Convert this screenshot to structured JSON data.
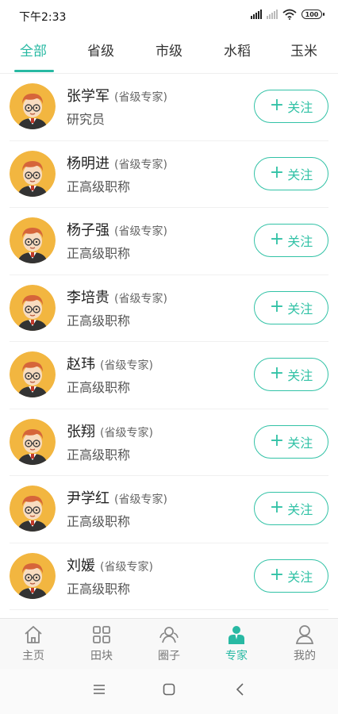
{
  "status": {
    "time": "下午2:33",
    "battery": "100"
  },
  "tabs": [
    {
      "label": "全部",
      "active": true
    },
    {
      "label": "省级"
    },
    {
      "label": "市级"
    },
    {
      "label": "水稻"
    },
    {
      "label": "玉米"
    }
  ],
  "experts": [
    {
      "name": "张学军",
      "role": "(省级专家)",
      "title": "研究员",
      "follow": "关注"
    },
    {
      "name": "杨明进",
      "role": "(省级专家)",
      "title": "正高级职称",
      "follow": "关注"
    },
    {
      "name": "杨子强",
      "role": "(省级专家)",
      "title": "正高级职称",
      "follow": "关注"
    },
    {
      "name": "李培贵",
      "role": "(省级专家)",
      "title": "正高级职称",
      "follow": "关注"
    },
    {
      "name": "赵玮",
      "role": "(省级专家)",
      "title": "正高级职称",
      "follow": "关注"
    },
    {
      "name": "张翔",
      "role": "(省级专家)",
      "title": "正高级职称",
      "follow": "关注"
    },
    {
      "name": "尹学红",
      "role": "(省级专家)",
      "title": "正高级职称",
      "follow": "关注"
    },
    {
      "name": "刘媛",
      "role": "(省级专家)",
      "title": "正高级职称",
      "follow": "关注"
    }
  ],
  "bottom_nav": [
    {
      "label": "主页",
      "icon": "home-icon"
    },
    {
      "label": "田块",
      "icon": "grid-icon"
    },
    {
      "label": "圈子",
      "icon": "community-icon"
    },
    {
      "label": "专家",
      "icon": "expert-icon",
      "active": true
    },
    {
      "label": "我的",
      "icon": "profile-icon"
    }
  ],
  "colors": {
    "accent": "#28b9a3",
    "follow_border": "#32c2a6",
    "avatar_bg": "#f2b640"
  }
}
